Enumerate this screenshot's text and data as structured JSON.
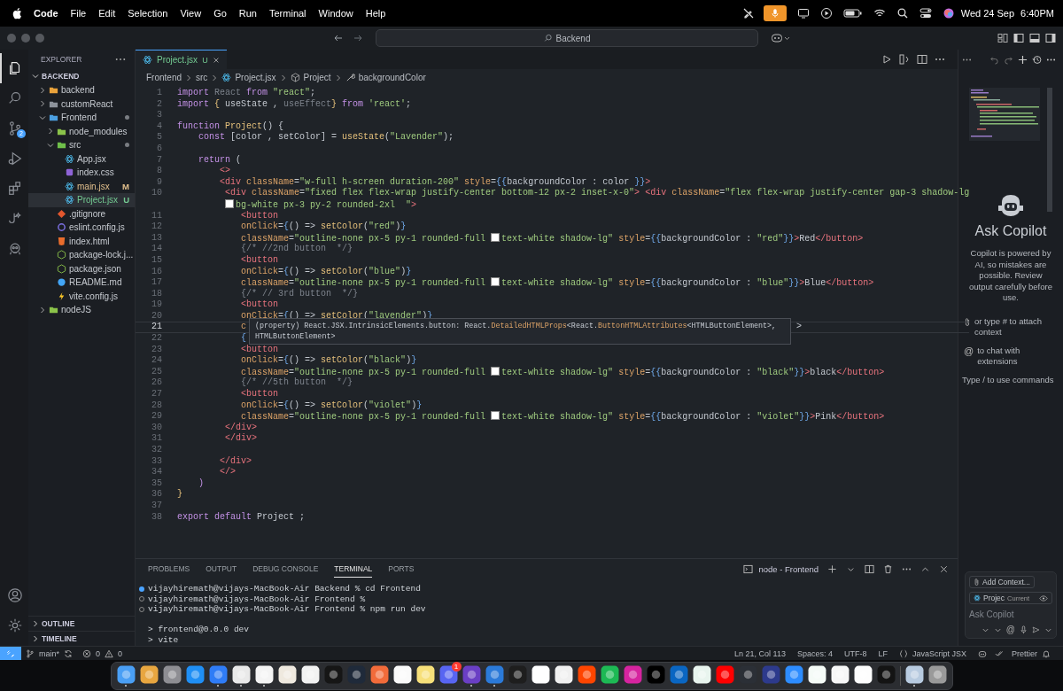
{
  "menu_bar": {
    "app": "Code",
    "items": [
      "File",
      "Edit",
      "Selection",
      "View",
      "Go",
      "Run",
      "Terminal",
      "Window",
      "Help"
    ],
    "date": "Wed 24 Sep",
    "time": "6:40PM"
  },
  "title_bar": {
    "search": "Backend"
  },
  "activity_bar": {
    "items": [
      {
        "kind": "explorer",
        "selected": true
      },
      {
        "kind": "search",
        "selected": false
      },
      {
        "kind": "source-control",
        "selected": false,
        "badge": "2"
      },
      {
        "kind": "run",
        "selected": false
      },
      {
        "kind": "extensions",
        "selected": false
      },
      {
        "kind": "flask",
        "selected": false
      },
      {
        "kind": "robot",
        "selected": false
      }
    ],
    "bottom": [
      {
        "kind": "account"
      },
      {
        "kind": "settings"
      }
    ]
  },
  "sidebar": {
    "title": "EXPLORER",
    "root": {
      "label": "BACKEND",
      "expanded": true
    },
    "tree": [
      {
        "label": "backend",
        "kind": "folder",
        "color": "#e9a23b",
        "expanded": false,
        "selected": false,
        "changed": false
      },
      {
        "label": "customReact",
        "kind": "folder",
        "color": "#8d939b",
        "expanded": false,
        "selected": false,
        "changed": false
      },
      {
        "label": "Frontend",
        "kind": "folder",
        "color": "#4b9fe0",
        "expanded": true,
        "selected": false,
        "changed": true,
        "children": [
          {
            "label": "node_modules",
            "kind": "folder",
            "color": "#8bc34a",
            "expanded": false,
            "selected": false,
            "changed": false
          },
          {
            "label": "src",
            "kind": "folder",
            "color": "#6fbf4a",
            "expanded": true,
            "selected": false,
            "changed": true,
            "children": [
              {
                "label": "App.jsx",
                "kind": "react",
                "selected": false,
                "changed": false
              },
              {
                "label": "index.css",
                "kind": "css",
                "selected": false,
                "changed": false
              },
              {
                "label": "main.jsx",
                "kind": "react",
                "selected": false,
                "changed": true,
                "badge": "M",
                "color": "#e2c08d"
              },
              {
                "label": "Project.jsx",
                "kind": "react",
                "selected": true,
                "changed": true,
                "badge": "U",
                "color": "#73c991"
              }
            ]
          },
          {
            "label": ".gitignore",
            "kind": "git",
            "selected": false,
            "changed": false
          },
          {
            "label": "eslint.config.js",
            "kind": "eslint",
            "selected": false,
            "changed": false
          },
          {
            "label": "index.html",
            "kind": "html",
            "selected": false,
            "changed": false
          },
          {
            "label": "package-lock.j...",
            "kind": "node",
            "selected": false,
            "changed": false
          },
          {
            "label": "package.json",
            "kind": "node",
            "selected": false,
            "changed": false
          },
          {
            "label": "README.md",
            "kind": "info",
            "selected": false,
            "changed": false
          },
          {
            "label": "vite.config.js",
            "kind": "vite",
            "selected": false,
            "changed": false
          }
        ]
      },
      {
        "label": "nodeJS",
        "kind": "folder",
        "color": "#8bc34a",
        "expanded": false,
        "selected": false,
        "changed": false
      }
    ],
    "sections": [
      {
        "label": "OUTLINE",
        "expanded": false
      },
      {
        "label": "TIMELINE",
        "expanded": false
      }
    ]
  },
  "editor": {
    "tabs": [
      {
        "label": "Project.jsx",
        "badge": "U",
        "selected": true
      }
    ],
    "breadcrumb": [
      {
        "kind": "folder",
        "text": "Frontend"
      },
      {
        "kind": "folder",
        "text": "src"
      },
      {
        "kind": "react",
        "text": "Project.jsx"
      },
      {
        "kind": "function",
        "text": "Project"
      },
      {
        "kind": "property",
        "text": "backgroundColor"
      }
    ],
    "lines": [
      {
        "number": "1",
        "current": false,
        "tokens": [
          {
            "kind": "kw",
            "text": "import"
          },
          {
            "kind": "dim",
            "text": " React "
          },
          {
            "kind": "kw",
            "text": "from"
          },
          {
            "kind": "str",
            "text": " \"react\""
          },
          {
            "kind": "plain",
            "text": ";"
          }
        ]
      },
      {
        "number": "2",
        "current": false,
        "tokens": [
          {
            "kind": "kw",
            "text": "import"
          },
          {
            "kind": "fn",
            "text": " { "
          },
          {
            "kind": "plain",
            "text": "useState , "
          },
          {
            "kind": "dim",
            "text": "useEffect"
          },
          {
            "kind": "fn",
            "text": "}"
          },
          {
            "kind": "kw",
            "text": " from "
          },
          {
            "kind": "str",
            "text": "'react'"
          },
          {
            "kind": "plain",
            "text": ";"
          }
        ]
      },
      {
        "number": "3",
        "current": false
      },
      {
        "number": "4",
        "current": false,
        "tokens": [
          {
            "kind": "kw",
            "text": "function"
          },
          {
            "kind": "fn",
            "text": " Project"
          },
          {
            "kind": "plain",
            "text": "() {"
          }
        ]
      },
      {
        "number": "5",
        "current": false,
        "tokens": [
          {
            "kind": "kw",
            "text": "    const"
          },
          {
            "kind": "plain",
            "text": " [color , setColor] = "
          },
          {
            "kind": "fn",
            "text": "useState"
          },
          {
            "kind": "plain",
            "text": "("
          },
          {
            "kind": "str",
            "text": "\"Lavender\""
          },
          {
            "kind": "plain",
            "text": ");"
          }
        ]
      },
      {
        "number": "6",
        "current": false
      },
      {
        "number": "7",
        "current": false,
        "tokens": [
          {
            "kind": "kw",
            "text": "    return"
          },
          {
            "kind": "plain",
            "text": " ("
          }
        ]
      },
      {
        "number": "8",
        "current": false,
        "tokens": [
          {
            "kind": "tag",
            "text": "        <>"
          }
        ]
      },
      {
        "number": "9",
        "current": false,
        "tokens": [
          {
            "kind": "tag",
            "text": "        <div"
          },
          {
            "kind": "attr",
            "text": " className"
          },
          {
            "kind": "plain",
            "text": "="
          },
          {
            "kind": "str",
            "text": "\"w-full h-screen duration-200\""
          },
          {
            "kind": "attr",
            "text": " style"
          },
          {
            "kind": "plain",
            "text": "="
          },
          {
            "kind": "punc",
            "text": "{{"
          },
          {
            "kind": "plain",
            "text": "backgroundColor : color "
          },
          {
            "kind": "punc",
            "text": "}}"
          },
          {
            "kind": "tag",
            "text": ">"
          }
        ]
      },
      {
        "number": "10",
        "current": false,
        "tokens": [
          {
            "kind": "tag",
            "text": "         <div"
          },
          {
            "kind": "attr",
            "text": " className"
          },
          {
            "kind": "plain",
            "text": "="
          },
          {
            "kind": "str",
            "text": "\"fixed flex flex-wrap justify-center bottom-12 px-2 inset-x-0\""
          },
          {
            "kind": "tag",
            "text": ">"
          },
          {
            "kind": "tag",
            "text": " <div"
          },
          {
            "kind": "attr",
            "text": " className"
          },
          {
            "kind": "plain",
            "text": "="
          },
          {
            "kind": "str",
            "text": "\"flex flex-wrap justify-center gap-3 shadow-lg"
          }
        ],
        "wrapped": [
          {
            "kind": "swatch",
            "color": "#ffffff"
          },
          {
            "kind": "str",
            "text": "bg-white px-3 py-2 rounded-2xl  \""
          },
          {
            "kind": "tag",
            "text": ">"
          }
        ]
      },
      {
        "number": "11",
        "current": false,
        "tokens": [
          {
            "kind": "tag",
            "text": "            <button"
          }
        ]
      },
      {
        "number": "12",
        "current": false,
        "tokens": [
          {
            "kind": "attr",
            "text": "            onClick"
          },
          {
            "kind": "plain",
            "text": "="
          },
          {
            "kind": "punc",
            "text": "{"
          },
          {
            "kind": "plain",
            "text": "() => "
          },
          {
            "kind": "fn",
            "text": "setColor"
          },
          {
            "kind": "plain",
            "text": "("
          },
          {
            "kind": "str",
            "text": "\"red\""
          },
          {
            "kind": "plain",
            "text": ")"
          },
          {
            "kind": "punc",
            "text": "}"
          }
        ]
      },
      {
        "number": "13",
        "current": false,
        "tokens": [
          {
            "kind": "attr",
            "text": "            className"
          },
          {
            "kind": "plain",
            "text": "="
          },
          {
            "kind": "str",
            "text": "\"outline-none px-5 py-1 rounded-full "
          },
          {
            "kind": "swatch",
            "color": "#ffffff"
          },
          {
            "kind": "str",
            "text": "text-white shadow-lg\""
          },
          {
            "kind": "attr",
            "text": " style"
          },
          {
            "kind": "plain",
            "text": "="
          },
          {
            "kind": "punc",
            "text": "{{"
          },
          {
            "kind": "plain",
            "text": "backgroundColor : "
          },
          {
            "kind": "str",
            "text": "\"red\""
          },
          {
            "kind": "punc",
            "text": "}}"
          },
          {
            "kind": "tag",
            "text": ">"
          },
          {
            "kind": "plain",
            "text": "Red"
          },
          {
            "kind": "tag",
            "text": "</button>"
          }
        ]
      },
      {
        "number": "14",
        "current": false,
        "tokens": [
          {
            "kind": "comment",
            "text": "            {/* //2nd button  */}"
          }
        ]
      },
      {
        "number": "15",
        "current": false,
        "tokens": [
          {
            "kind": "tag",
            "text": "            <button"
          }
        ]
      },
      {
        "number": "16",
        "current": false,
        "tokens": [
          {
            "kind": "attr",
            "text": "            onClick"
          },
          {
            "kind": "plain",
            "text": "="
          },
          {
            "kind": "punc",
            "text": "{"
          },
          {
            "kind": "plain",
            "text": "() => "
          },
          {
            "kind": "fn",
            "text": "setColor"
          },
          {
            "kind": "plain",
            "text": "("
          },
          {
            "kind": "str",
            "text": "\"blue\""
          },
          {
            "kind": "plain",
            "text": ")"
          },
          {
            "kind": "punc",
            "text": "}"
          }
        ]
      },
      {
        "number": "17",
        "current": false,
        "tokens": [
          {
            "kind": "attr",
            "text": "            className"
          },
          {
            "kind": "plain",
            "text": "="
          },
          {
            "kind": "str",
            "text": "\"outline-none px-5 py-1 rounded-full "
          },
          {
            "kind": "swatch",
            "color": "#ffffff"
          },
          {
            "kind": "str",
            "text": "text-white shadow-lg\""
          },
          {
            "kind": "attr",
            "text": " style"
          },
          {
            "kind": "plain",
            "text": "="
          },
          {
            "kind": "punc",
            "text": "{{"
          },
          {
            "kind": "plain",
            "text": "backgroundColor : "
          },
          {
            "kind": "str",
            "text": "\"blue\""
          },
          {
            "kind": "punc",
            "text": "}}"
          },
          {
            "kind": "tag",
            "text": ">"
          },
          {
            "kind": "plain",
            "text": "Blue"
          },
          {
            "kind": "tag",
            "text": "</button>"
          }
        ]
      },
      {
        "number": "18",
        "current": false,
        "tokens": [
          {
            "kind": "comment",
            "text": "            {/* // 3rd button  */}"
          }
        ]
      },
      {
        "number": "19",
        "current": false,
        "tokens": [
          {
            "kind": "tag",
            "text": "            <button"
          }
        ]
      },
      {
        "number": "20",
        "current": false,
        "tokens": [
          {
            "kind": "attr",
            "text": "            onClick"
          },
          {
            "kind": "plain",
            "text": "="
          },
          {
            "kind": "punc",
            "text": "{"
          },
          {
            "kind": "plain",
            "text": "() => "
          },
          {
            "kind": "fn",
            "text": "setColor"
          },
          {
            "kind": "plain",
            "text": "("
          },
          {
            "kind": "str",
            "text": "\"lavender\""
          },
          {
            "kind": "plain",
            "text": ")"
          },
          {
            "kind": "punc",
            "text": "}"
          }
        ]
      },
      {
        "number": "21",
        "current": true,
        "tokens": [
          {
            "kind": "attr",
            "text": "            c"
          },
          {
            "kind": "tail",
            "text": ">"
          }
        ]
      },
      {
        "number": "22",
        "current": false,
        "tokens": [
          {
            "kind": "punc",
            "text": "            {"
          }
        ]
      },
      {
        "number": "23",
        "current": false,
        "tokens": [
          {
            "kind": "tag",
            "text": "            <button"
          }
        ]
      },
      {
        "number": "24",
        "current": false,
        "tokens": [
          {
            "kind": "attr",
            "text": "            onClick"
          },
          {
            "kind": "plain",
            "text": "="
          },
          {
            "kind": "punc",
            "text": "{"
          },
          {
            "kind": "plain",
            "text": "() => "
          },
          {
            "kind": "fn",
            "text": "setColor"
          },
          {
            "kind": "plain",
            "text": "("
          },
          {
            "kind": "str",
            "text": "\"black\""
          },
          {
            "kind": "plain",
            "text": ")"
          },
          {
            "kind": "punc",
            "text": "}"
          }
        ]
      },
      {
        "number": "25",
        "current": false,
        "tokens": [
          {
            "kind": "attr",
            "text": "            className"
          },
          {
            "kind": "plain",
            "text": "="
          },
          {
            "kind": "str",
            "text": "\"outline-none px-5 py-1 rounded-full "
          },
          {
            "kind": "swatch",
            "color": "#ffffff"
          },
          {
            "kind": "str",
            "text": "text-white shadow-lg\""
          },
          {
            "kind": "attr",
            "text": " style"
          },
          {
            "kind": "plain",
            "text": "="
          },
          {
            "kind": "punc",
            "text": "{{"
          },
          {
            "kind": "plain",
            "text": "backgroundColor : "
          },
          {
            "kind": "str",
            "text": "\"black\""
          },
          {
            "kind": "punc",
            "text": "}}"
          },
          {
            "kind": "tag",
            "text": ">"
          },
          {
            "kind": "plain",
            "text": "black"
          },
          {
            "kind": "tag",
            "text": "</button>"
          }
        ]
      },
      {
        "number": "26",
        "current": false,
        "tokens": [
          {
            "kind": "comment",
            "text": "            {/* //5th button  */}"
          }
        ]
      },
      {
        "number": "27",
        "current": false,
        "tokens": [
          {
            "kind": "tag",
            "text": "            <button"
          }
        ]
      },
      {
        "number": "28",
        "current": false,
        "tokens": [
          {
            "kind": "attr",
            "text": "            onClick"
          },
          {
            "kind": "plain",
            "text": "="
          },
          {
            "kind": "punc",
            "text": "{"
          },
          {
            "kind": "plain",
            "text": "() => "
          },
          {
            "kind": "fn",
            "text": "setColor"
          },
          {
            "kind": "plain",
            "text": "("
          },
          {
            "kind": "str",
            "text": "\"violet\""
          },
          {
            "kind": "plain",
            "text": ")"
          },
          {
            "kind": "punc",
            "text": "}"
          }
        ]
      },
      {
        "number": "29",
        "current": false,
        "tokens": [
          {
            "kind": "attr",
            "text": "            className"
          },
          {
            "kind": "plain",
            "text": "="
          },
          {
            "kind": "str",
            "text": "\"outline-none px-5 py-1 rounded-full "
          },
          {
            "kind": "swatch",
            "color": "#ffffff"
          },
          {
            "kind": "str",
            "text": "text-white shadow-lg\""
          },
          {
            "kind": "attr",
            "text": " style"
          },
          {
            "kind": "plain",
            "text": "="
          },
          {
            "kind": "punc",
            "text": "{{"
          },
          {
            "kind": "plain",
            "text": "backgroundColor : "
          },
          {
            "kind": "str",
            "text": "\"violet\""
          },
          {
            "kind": "punc",
            "text": "}}"
          },
          {
            "kind": "tag",
            "text": ">"
          },
          {
            "kind": "plain",
            "text": "Pink"
          },
          {
            "kind": "tag",
            "text": "</button>"
          }
        ]
      },
      {
        "number": "30",
        "current": false,
        "tokens": [
          {
            "kind": "tag",
            "text": "         </div>"
          }
        ]
      },
      {
        "number": "31",
        "current": false,
        "tokens": [
          {
            "kind": "tag",
            "text": "         </div>"
          }
        ]
      },
      {
        "number": "32",
        "current": false
      },
      {
        "number": "33",
        "current": false,
        "tokens": [
          {
            "kind": "tag",
            "text": "        </div>"
          }
        ]
      },
      {
        "number": "34",
        "current": false,
        "tokens": [
          {
            "kind": "tag",
            "text": "        </>"
          }
        ]
      },
      {
        "number": "35",
        "current": false,
        "tokens": [
          {
            "kind": "kw",
            "text": "    )"
          }
        ]
      },
      {
        "number": "36",
        "current": false,
        "tokens": [
          {
            "kind": "fn",
            "text": "}"
          }
        ]
      },
      {
        "number": "37",
        "current": false
      },
      {
        "number": "38",
        "current": false,
        "tokens": [
          {
            "kind": "kw",
            "text": "export default"
          },
          {
            "kind": "plain",
            "text": " Project ;"
          }
        ]
      }
    ],
    "tooltip": [
      {
        "kind": "plain",
        "text": "(property) React.JSX.IntrinsicElements.button: React."
      },
      {
        "kind": "type",
        "text": "DetailedHTMLProps"
      },
      {
        "kind": "plain",
        "text": "<React."
      },
      {
        "kind": "type",
        "text": "ButtonHTMLAttributes"
      },
      {
        "kind": "plain",
        "text": "<HTMLButtonElement>, HTMLButtonElement>"
      }
    ]
  },
  "panel": {
    "tabs": [
      {
        "label": "PROBLEMS",
        "selected": false
      },
      {
        "label": "OUTPUT",
        "selected": false
      },
      {
        "label": "DEBUG CONSOLE",
        "selected": false
      },
      {
        "label": "TERMINAL",
        "selected": true
      },
      {
        "label": "PORTS",
        "selected": false
      }
    ],
    "terminal_name": "node - Frontend",
    "lines": [
      {
        "kind": "success",
        "text": "vijayhiremath@vijays-MacBook-Air Backend % cd Frontend"
      },
      {
        "kind": "empty",
        "text": "vijayhiremath@vijays-MacBook-Air Frontend %"
      },
      {
        "kind": "empty",
        "text": "vijayhiremath@vijays-MacBook-Air Frontend % npm run dev"
      },
      {
        "kind": "blank"
      },
      {
        "kind": "output",
        "text": "> frontend@0.0.0 dev"
      },
      {
        "kind": "output",
        "text": "> vite"
      }
    ]
  },
  "copilot": {
    "title": "Ask Copilot",
    "description": "Copilot is powered by AI, so mistakes are possible. Review output carefully before use.",
    "hints": [
      {
        "kind": "attach",
        "text": "or type # to attach context"
      },
      {
        "kind": "mention",
        "symbol": "@",
        "text": "to chat with extensions"
      },
      {
        "kind": "plain",
        "text": "Type / to use commands"
      }
    ],
    "add_context": "Add Context...",
    "file_chip": "Projec",
    "file_chip_note": "Current",
    "placeholder": "Ask Copilot",
    "mention_button": "@"
  },
  "status_bar": {
    "branch": "main*",
    "errors": "0",
    "warnings": "0",
    "position": "Ln 21, Col 113",
    "indent": "Spaces: 4",
    "encoding": "UTF-8",
    "eol": "LF",
    "language": "JavaScript JSX",
    "formatter": "Prettier"
  },
  "dock": [
    {
      "color": "#4a9ff5",
      "running": true
    },
    {
      "color": "#e8a640",
      "running": false
    },
    {
      "color": "#8e8e93",
      "running": false
    },
    {
      "color": "#1f8ff5",
      "running": false
    },
    {
      "color": "#2f7cf6",
      "running": true
    },
    {
      "color": "#e9e9e9",
      "running": true
    },
    {
      "color": "#f4f4f4",
      "running": true
    },
    {
      "color": "#efe9df",
      "running": false
    },
    {
      "color": "#f2f2f2",
      "running": false
    },
    {
      "color": "#161616",
      "running": false
    },
    {
      "color": "#1f2a3a",
      "running": false
    },
    {
      "color": "#f26b3a",
      "running": false
    },
    {
      "color": "#fafafa",
      "running": false
    },
    {
      "color": "#f7e07a",
      "running": false
    },
    {
      "color": "#5865f2",
      "running": false,
      "badge": "1"
    },
    {
      "color": "#6a3fc4",
      "running": true
    },
    {
      "color": "#2b7ad9",
      "running": true
    },
    {
      "color": "#1e1e1e",
      "running": false
    },
    {
      "color": "#ffffff",
      "running": false
    },
    {
      "color": "#f0f0f0",
      "running": false
    },
    {
      "color": "#ff4500",
      "running": false
    },
    {
      "color": "#1db954",
      "running": false
    },
    {
      "color": "#d6249f",
      "running": false
    },
    {
      "color": "#000000",
      "running": false
    },
    {
      "color": "#0a66c2",
      "running": false
    },
    {
      "color": "#e8f4ee",
      "running": false
    },
    {
      "color": "#ff0000",
      "running": false
    },
    {
      "color": "#2b2f36",
      "running": false
    },
    {
      "color": "#2d3a8c",
      "running": false
    },
    {
      "color": "#2d8cff",
      "running": false
    },
    {
      "color": "#f5fbf7",
      "running": false
    },
    {
      "color": "#f7f7f7",
      "running": false
    },
    {
      "color": "#fdfdfd",
      "running": false
    },
    {
      "color": "#141414",
      "running": false
    },
    {
      "color": "#b8cbe0",
      "running": true,
      "after_divider": true
    },
    {
      "color": "#9a9a9a",
      "running": false
    }
  ]
}
